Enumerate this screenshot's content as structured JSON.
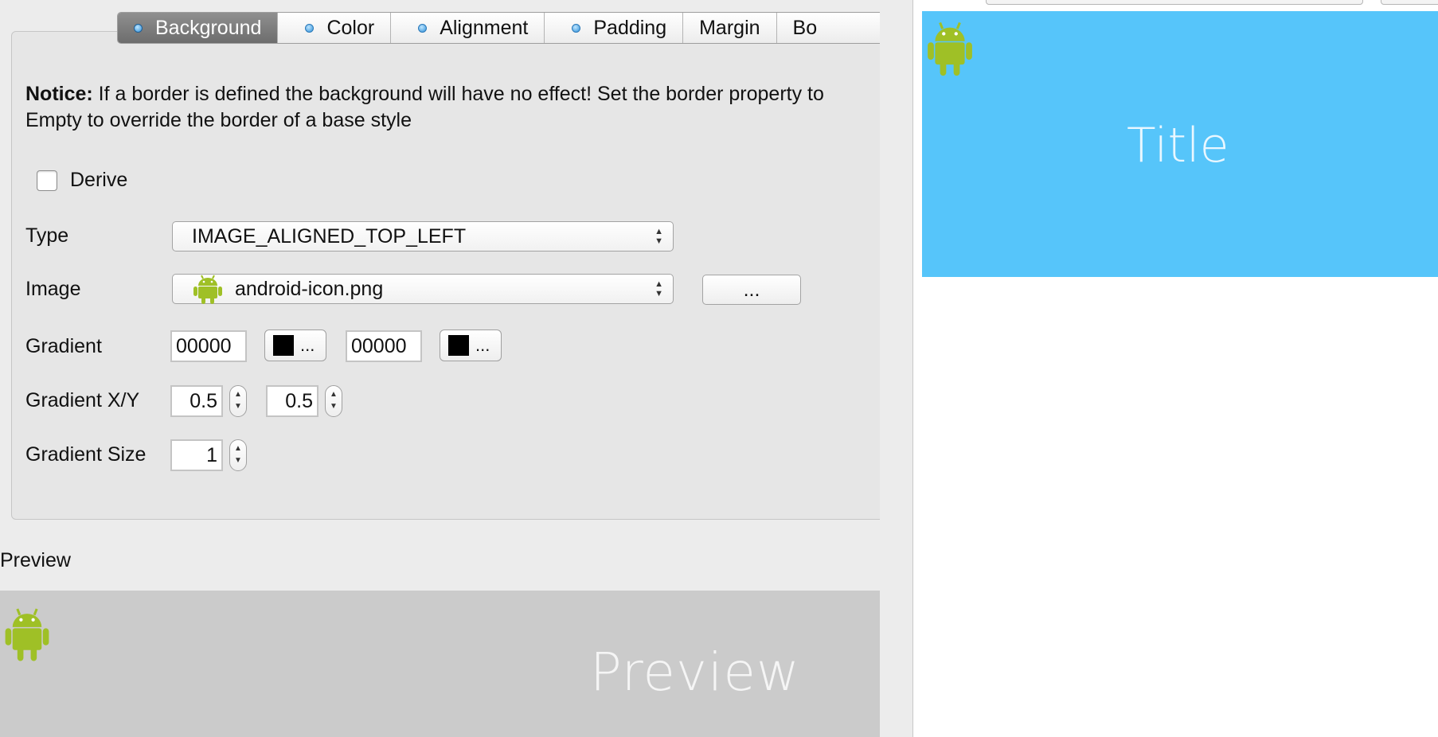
{
  "tabs": [
    {
      "label": "Background",
      "active": true,
      "has_dot": true
    },
    {
      "label": "Color",
      "active": false,
      "has_dot": true
    },
    {
      "label": "Alignment",
      "active": false,
      "has_dot": true
    },
    {
      "label": "Padding",
      "active": false,
      "has_dot": true
    },
    {
      "label": "Margin",
      "active": false,
      "has_dot": false
    },
    {
      "label": "Bo",
      "active": false,
      "has_dot": false
    }
  ],
  "notice": {
    "bold": "Notice:",
    "text": " If a border is defined the background will have no effect! Set the border property to Empty to override the border of a base style"
  },
  "derive": {
    "label": "Derive",
    "checked": false
  },
  "type": {
    "label": "Type",
    "value": "IMAGE_ALIGNED_TOP_LEFT"
  },
  "image": {
    "label": "Image",
    "value": "android-icon.png",
    "browse_label": "..."
  },
  "gradient": {
    "label": "Gradient",
    "color1": "00000",
    "color1_button": "...",
    "color2": "00000",
    "color2_button": "..."
  },
  "gradient_xy": {
    "label": "Gradient X/Y",
    "x": "0.5",
    "y": "0.5"
  },
  "gradient_size": {
    "label": "Gradient Size",
    "value": "1"
  },
  "preview": {
    "label": "Preview",
    "text": "Preview",
    "background": "#cbcbcb"
  },
  "title_preview": {
    "text": "Title",
    "background": "#56c5fa"
  },
  "icons": {
    "image_option": "android-icon",
    "preview": "android-icon",
    "title": "android-icon"
  },
  "colors": {
    "android": "#9fc026",
    "swatch": "#000000",
    "tab_active": "#7d7d7d"
  }
}
